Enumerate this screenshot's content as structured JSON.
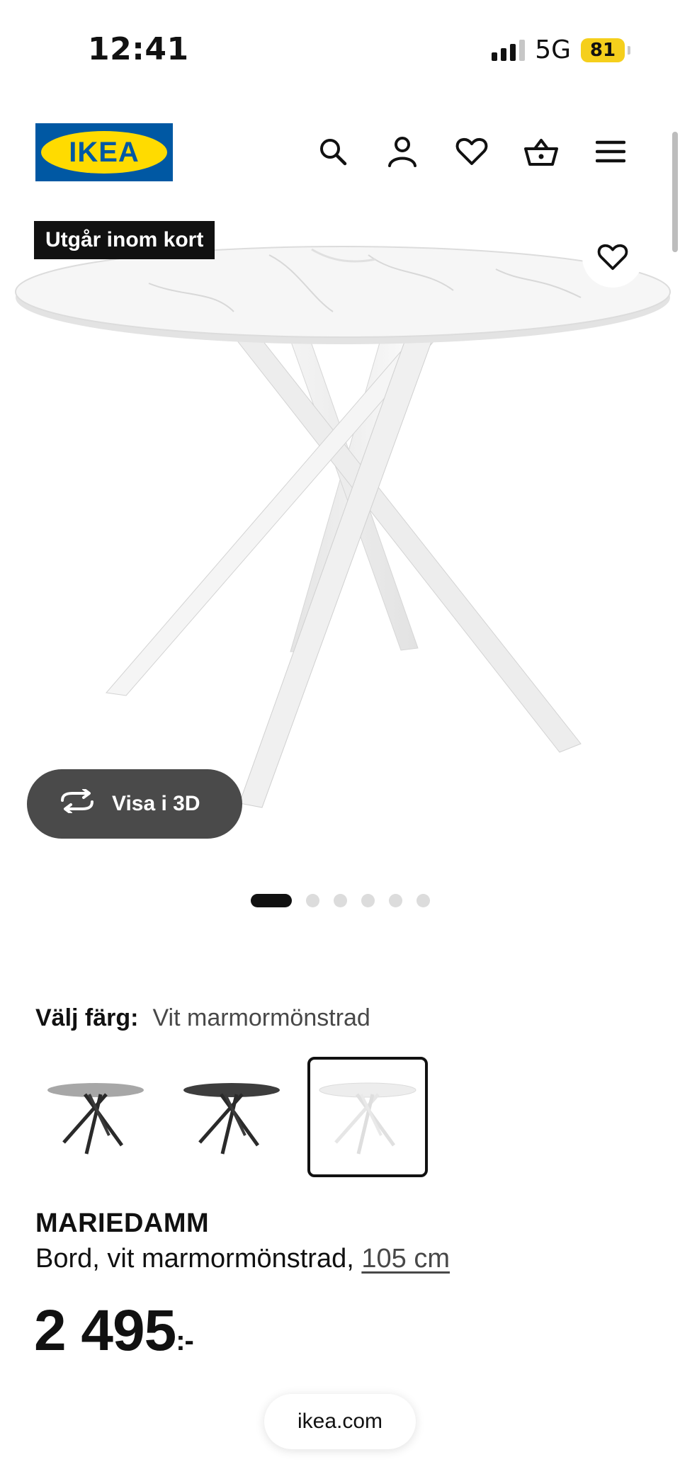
{
  "status_bar": {
    "time": "12:41",
    "network": "5G",
    "battery": "81"
  },
  "header": {
    "logo_text": "IKEA"
  },
  "hero": {
    "badge": "Utgår inom kort",
    "view_3d_label": "Visa i 3D",
    "image_count": 6,
    "active_image_index": 0
  },
  "color_picker": {
    "label": "Välj färg:",
    "selected_value": "Vit marmormönstrad",
    "options": [
      "grey-marble-table",
      "dark-grey-table",
      "white-marble-table"
    ],
    "selected_index": 2
  },
  "product": {
    "name": "MARIEDAMM",
    "description": "Bord, vit marmormönstrad,",
    "size": "105 cm",
    "price": "2 495",
    "price_suffix": ":-"
  },
  "browser": {
    "url": "ikea.com"
  },
  "colors": {
    "ikea_blue": "#0058a3",
    "ikea_yellow": "#ffdb00",
    "battery": "#f5cf1c",
    "pill_dark": "#4a4a4a"
  }
}
